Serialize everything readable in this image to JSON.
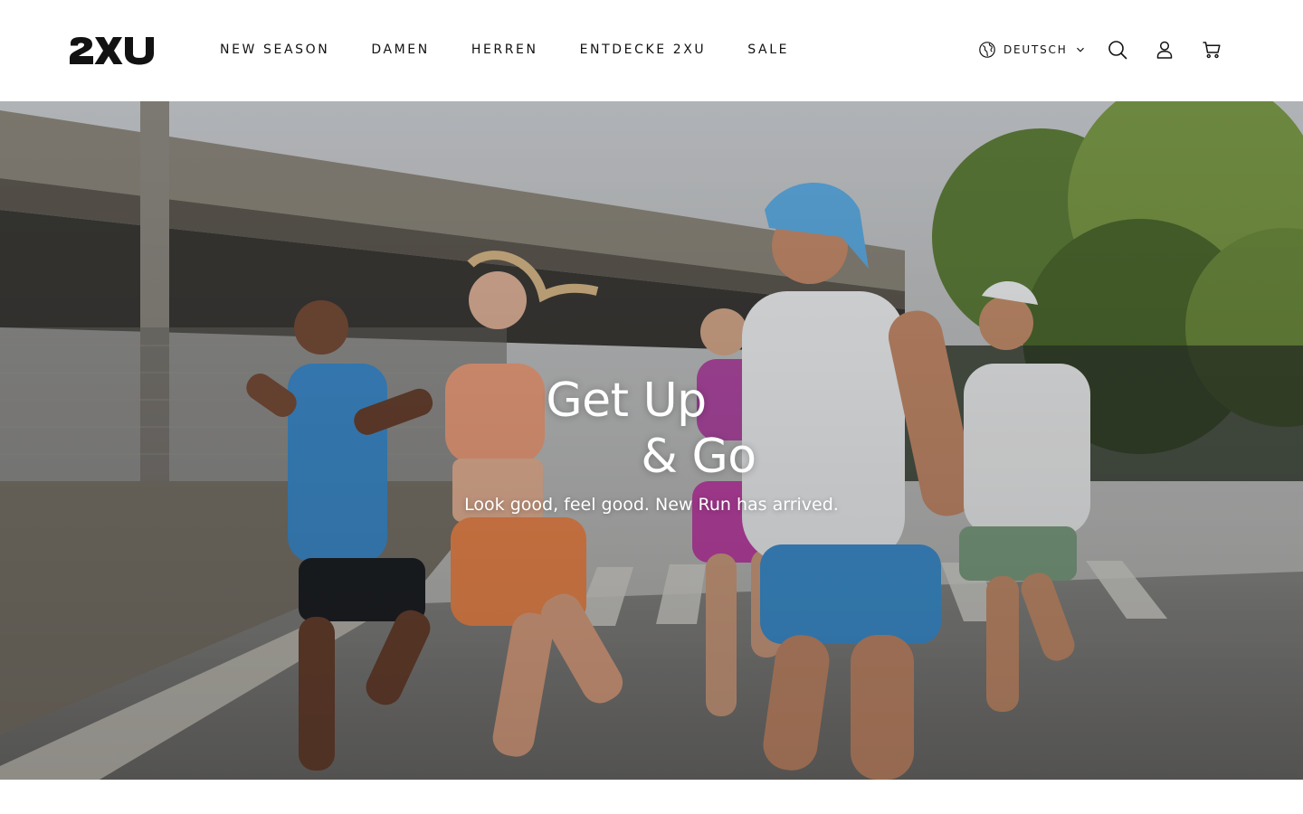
{
  "brand": {
    "logo_text": "2XU"
  },
  "nav": {
    "items": [
      {
        "label": "NEW SEASON"
      },
      {
        "label": "DAMEN"
      },
      {
        "label": "HERREN"
      },
      {
        "label": "ENTDECKE 2XU"
      },
      {
        "label": "SALE"
      }
    ]
  },
  "header": {
    "language_label": "DEUTSCH",
    "icons": {
      "language": "globe-icon",
      "language_caret": "chevron-down-icon",
      "search": "search-icon",
      "account": "account-icon",
      "cart": "cart-icon"
    }
  },
  "hero": {
    "title_line1": "Get Up",
    "title_line2": "& Go",
    "subtitle": "Look good, feel good. New Run has arrived."
  },
  "colors": {
    "text": "#121212",
    "header_bg": "#ffffff",
    "hero_text": "#ffffff"
  }
}
